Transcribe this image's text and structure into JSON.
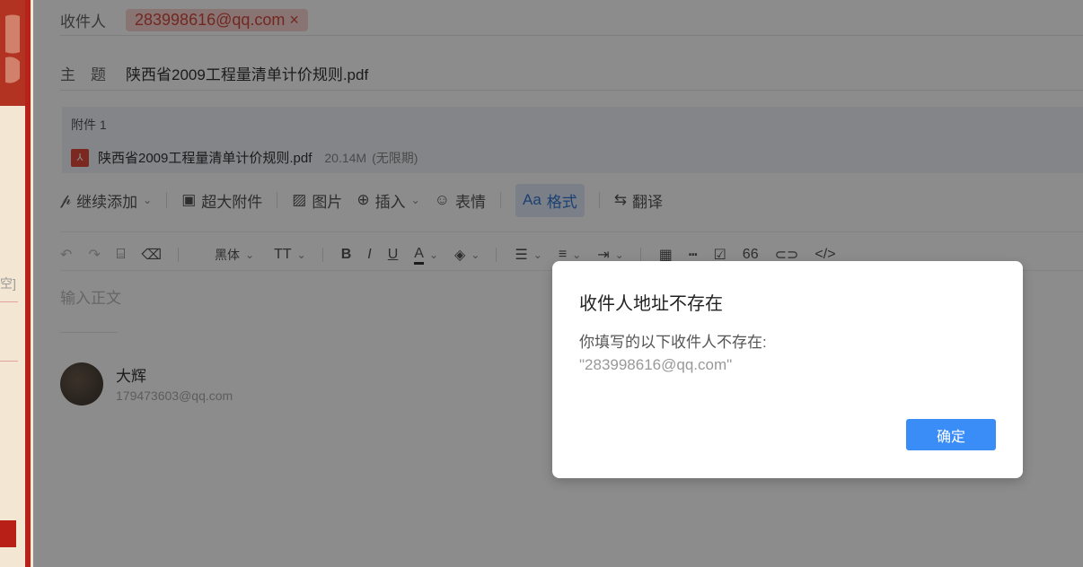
{
  "left": {
    "partial_text": "空]"
  },
  "compose": {
    "recipient_label": "收件人",
    "recipient_chip": "283998616@qq.com ×",
    "subject_label": "主　题",
    "subject_value": "陕西省2009工程量清单计价规则.pdf",
    "attachments": {
      "title": "附件 1",
      "file_name": "陕西省2009工程量清单计价规则.pdf",
      "file_size": "20.14M",
      "expiry": "(无限期)"
    },
    "toolbar": {
      "add_more": "继续添加",
      "large_attachment": "超大附件",
      "image": "图片",
      "insert": "插入",
      "emoji": "表情",
      "format": "格式",
      "format_prefix": "Aa",
      "translate": "翻译"
    },
    "editor_toolbar": {
      "font": "黑体",
      "font_size_label": "TT",
      "bold": "B",
      "italic": "I",
      "underline": "U",
      "font_color": "A",
      "quote": "66",
      "code": "</>"
    },
    "body_placeholder": "输入正文",
    "signature": {
      "name": "大辉",
      "email": "179473603@qq.com"
    }
  },
  "dialog": {
    "title": "收件人地址不存在",
    "message": "你填写的以下收件人不存在:",
    "address": "\"283998616@qq.com\"",
    "confirm_label": "确定"
  },
  "colors": {
    "accent": "#3a8cf7",
    "chip_bg": "#f7d6d2",
    "chip_text": "#d2473c",
    "left_border": "#b7231a"
  }
}
